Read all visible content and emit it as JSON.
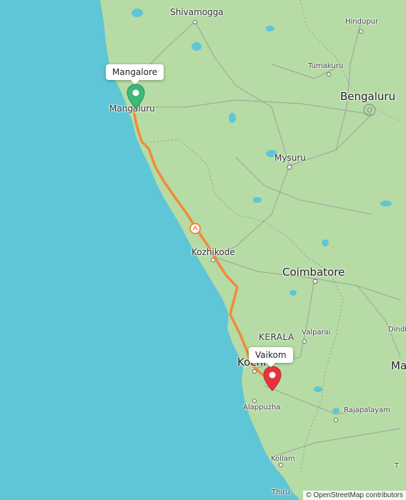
{
  "map": {
    "colors": {
      "sea": "#5ec6d6",
      "land": "#b6dba5",
      "route": "#f08a3a",
      "start": "#3cb878",
      "end": "#e8333f"
    },
    "labels": {
      "shivamogga": "Shivamogga",
      "hindupur": "Hindupur",
      "tumakuru": "Tumakuru",
      "bengaluru": "Bengaluru",
      "mangaluru": "Mangaluru",
      "mysuru": "Mysuru",
      "kozhikode": "Kozhikode",
      "coimbatore": "Coimbatore",
      "kerala": "KERALA",
      "valparai": "Valparai",
      "dindigul": "Dindi",
      "kochi": "Kochi",
      "madurai": "Ma",
      "alappuzha": "Alappuzha",
      "rajapalayam": "Rajapalayam",
      "kollam": "Kollam",
      "thiruvananthapuram": "Thiru",
      "tenkasi": "T"
    },
    "callouts": {
      "start": "Mangalore",
      "end": "Vaikom"
    },
    "icons": {
      "start": "green-pin-icon",
      "end": "red-pin-icon",
      "waypoint": "route-waypoint-icon"
    },
    "attribution": "© OpenStreetMap contributors"
  }
}
